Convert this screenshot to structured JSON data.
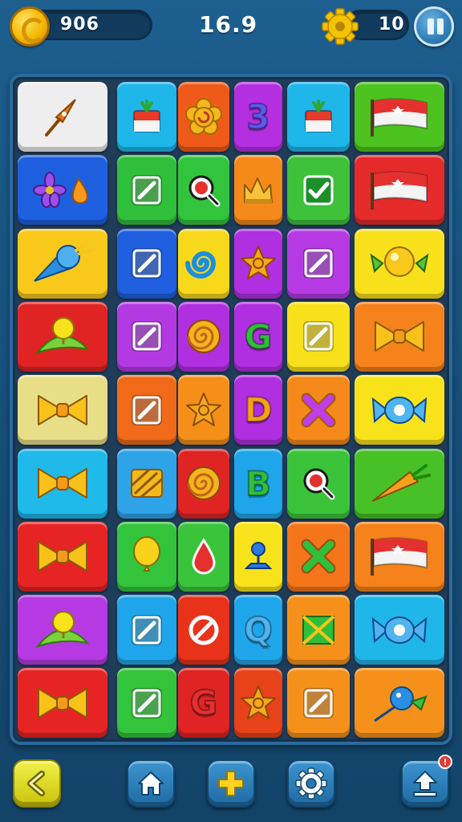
{
  "hud": {
    "coins": "906",
    "timer": "16.9",
    "gears": "10",
    "coin_icon": "coin-icon",
    "gear_icon": "gear-icon",
    "pause_icon": "pause-icon"
  },
  "board": {
    "rows": 9,
    "columns": 6,
    "tiles": [
      [
        {
          "color": "#eeeeee",
          "icon": "pen-nib"
        },
        {
          "color": "#1fb6ea",
          "icon": "gift-box"
        },
        {
          "color": "#ef5a1a",
          "icon": "flower-swirl"
        },
        {
          "color": "#b42fe0",
          "icon": "letter",
          "text": "3"
        },
        {
          "color": "#1fb6ea",
          "icon": "gift-box"
        },
        {
          "color": "#4cc31f",
          "icon": "flag"
        }
      ],
      [
        {
          "color": "#1e5fe0",
          "icon": "flower-and-drop"
        },
        {
          "color": "#2fbf3a",
          "icon": "slash-square"
        },
        {
          "color": "#32c43c",
          "icon": "magnifier"
        },
        {
          "color": "#f58a1a",
          "icon": "crown"
        },
        {
          "color": "#3dc23a",
          "icon": "check-square"
        },
        {
          "color": "#e52a2a",
          "icon": "flag"
        }
      ],
      [
        {
          "color": "#f8c81a",
          "icon": "ice-cream"
        },
        {
          "color": "#1f5fe0",
          "icon": "slash-square"
        },
        {
          "color": "#f8d81a",
          "icon": "swirl"
        },
        {
          "color": "#b02fe0",
          "icon": "star-cookie"
        },
        {
          "color": "#b53ae3",
          "icon": "slash-square"
        },
        {
          "color": "#f8e11a",
          "icon": "candy-balloon"
        }
      ],
      [
        {
          "color": "#e02424",
          "icon": "lollipop"
        },
        {
          "color": "#b33ae3",
          "icon": "slash-square"
        },
        {
          "color": "#b02fe0",
          "icon": "spiral-cookie"
        },
        {
          "color": "#b02fe0",
          "icon": "letter",
          "text": "G"
        },
        {
          "color": "#f8e01a",
          "icon": "slash-square"
        },
        {
          "color": "#f5821a",
          "icon": "bow"
        }
      ],
      [
        {
          "color": "#e8de88",
          "icon": "bow"
        },
        {
          "color": "#f06a1a",
          "icon": "slash-square"
        },
        {
          "color": "#f58f1a",
          "icon": "star-cookie"
        },
        {
          "color": "#b02fe0",
          "icon": "letter",
          "text": "D"
        },
        {
          "color": "#f58a1a",
          "icon": "cross"
        },
        {
          "color": "#f8e31a",
          "icon": "candy"
        }
      ],
      [
        {
          "color": "#1fb9ea",
          "icon": "bow"
        },
        {
          "color": "#2fa3e8",
          "icon": "waffle"
        },
        {
          "color": "#e02424",
          "icon": "spiral-cookie"
        },
        {
          "color": "#1fa6ea",
          "icon": "letter",
          "text": "B"
        },
        {
          "color": "#3bc43a",
          "icon": "magnifier"
        },
        {
          "color": "#47c125",
          "icon": "carrot"
        }
      ],
      [
        {
          "color": "#e62424",
          "icon": "bow"
        },
        {
          "color": "#34c43c",
          "icon": "balloon"
        },
        {
          "color": "#3ac43c",
          "icon": "drop"
        },
        {
          "color": "#f8e31a",
          "icon": "pin"
        },
        {
          "color": "#f5761a",
          "icon": "cross"
        },
        {
          "color": "#f5821a",
          "icon": "flag"
        }
      ],
      [
        {
          "color": "#b53ae3",
          "icon": "lollipop"
        },
        {
          "color": "#1fa6ea",
          "icon": "slash-square"
        },
        {
          "color": "#e8321a",
          "icon": "no-sign"
        },
        {
          "color": "#1fa6ea",
          "icon": "letter",
          "text": "Q"
        },
        {
          "color": "#f5911a",
          "icon": "envelope"
        },
        {
          "color": "#1fb6ea",
          "icon": "candy"
        }
      ],
      [
        {
          "color": "#e62424",
          "icon": "bow"
        },
        {
          "color": "#34c43c",
          "icon": "slash-square"
        },
        {
          "color": "#e02424",
          "icon": "letter",
          "text": "G"
        },
        {
          "color": "#e8421a",
          "icon": "star-cookie"
        },
        {
          "color": "#f5911a",
          "icon": "slash-square"
        },
        {
          "color": "#f5911a",
          "icon": "bird-balloon"
        }
      ]
    ]
  },
  "bottom_bar": {
    "badge_text": "!",
    "buttons": [
      "back-arrow-icon",
      "home-icon",
      "plus-icon",
      "settings-icon",
      "upload-icon"
    ]
  }
}
